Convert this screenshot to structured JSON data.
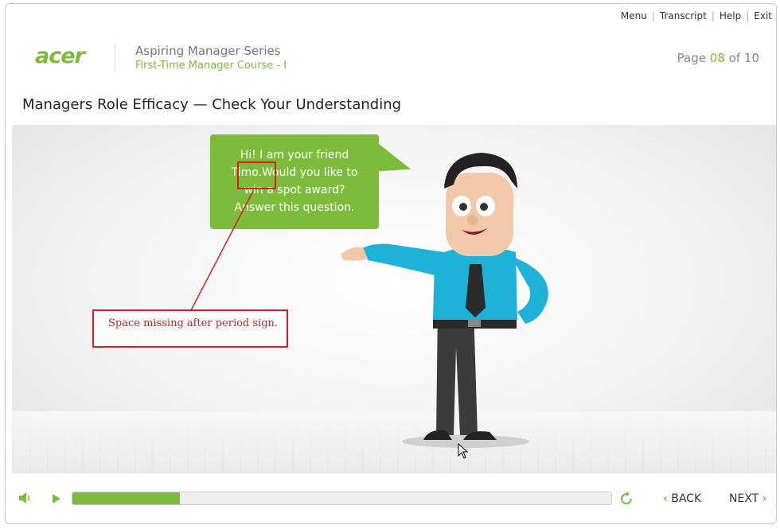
{
  "topnav": {
    "menu": "Menu",
    "transcript": "Transcript",
    "help": "Help",
    "exit": "Exit"
  },
  "brand": {
    "logo_text": "acer",
    "series": "Aspiring Manager Series",
    "course": "First-Time Manager Course - I"
  },
  "pagination": {
    "label": "Page",
    "current": "08",
    "of": "of",
    "total": "10"
  },
  "page_title": "Managers Role Efficacy — Check Your Understanding",
  "bubble": {
    "line1": "Hi! I am your friend",
    "line2": "Timo.Would you like to",
    "line3": "win a spot award?",
    "line4": "Answer this question."
  },
  "annotation": {
    "text": "Space missing after period sign."
  },
  "player": {
    "progress_fraction": 0.2,
    "back_label": "BACK",
    "next_label": "NEXT"
  },
  "colors": {
    "accent": "#7cbc3a",
    "annotation": "#d42020",
    "shirt": "#1fb2d8"
  },
  "icons": {
    "volume": "speaker-icon",
    "play": "play-icon",
    "replay": "replay-icon",
    "back": "chevron-left-icon",
    "next": "chevron-right-icon"
  }
}
